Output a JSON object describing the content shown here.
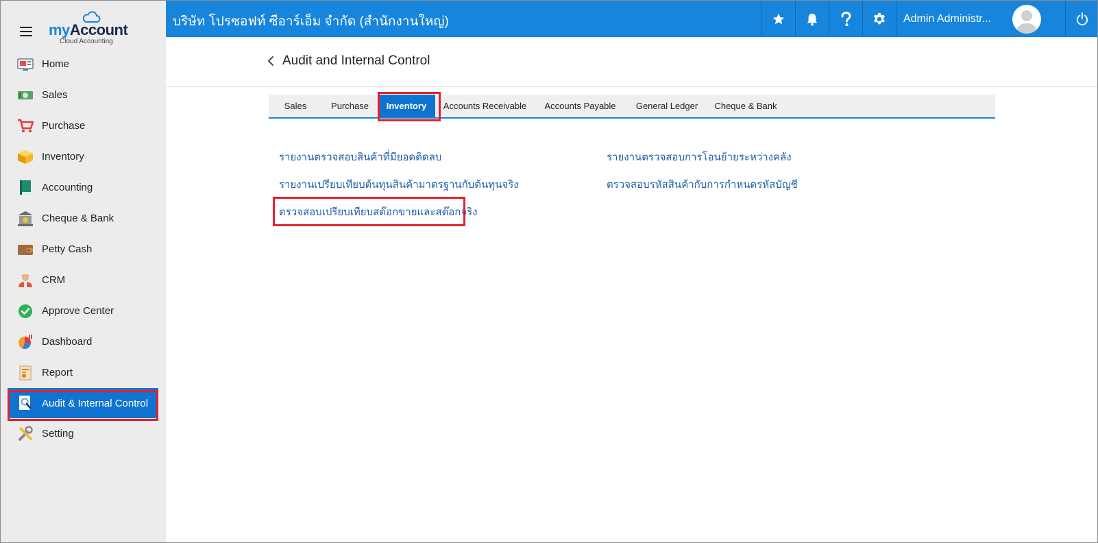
{
  "app": {
    "logo_my": "my",
    "logo_account": "Account",
    "logo_sub": "Cloud Accounting"
  },
  "topbar": {
    "company": "บริษัท โปรซอฟท์ ซีอาร์เอ็ม จำกัด (สำนักงานใหญ่)",
    "user_name": "Admin Administr..."
  },
  "sidebar": {
    "items": [
      {
        "label": "Home",
        "icon": "home-icon"
      },
      {
        "label": "Sales",
        "icon": "sales-icon"
      },
      {
        "label": "Purchase",
        "icon": "cart-icon"
      },
      {
        "label": "Inventory",
        "icon": "box-icon"
      },
      {
        "label": "Accounting",
        "icon": "book-icon"
      },
      {
        "label": "Cheque & Bank",
        "icon": "bank-icon"
      },
      {
        "label": "Petty Cash",
        "icon": "wallet-icon"
      },
      {
        "label": "CRM",
        "icon": "crm-icon"
      },
      {
        "label": "Approve Center",
        "icon": "check-circle-icon"
      },
      {
        "label": "Dashboard",
        "icon": "pie-chart-icon"
      },
      {
        "label": "Report",
        "icon": "report-icon"
      },
      {
        "label": "Audit & Internal Control",
        "icon": "audit-icon"
      },
      {
        "label": "Setting",
        "icon": "tools-icon"
      }
    ],
    "active_index": 11
  },
  "page": {
    "title": "Audit and Internal Control"
  },
  "tabs": [
    {
      "label": "Sales"
    },
    {
      "label": "Purchase"
    },
    {
      "label": "Inventory"
    },
    {
      "label": "Accounts Receivable"
    },
    {
      "label": "Accounts Payable"
    },
    {
      "label": "General Ledger"
    },
    {
      "label": "Cheque & Bank"
    }
  ],
  "active_tab": "Inventory",
  "links": {
    "left": [
      "รายงานตรวจสอบสินค้าที่มียอดติดลบ",
      "รายงานเปรียบเทียบต้นทุนสินค้ามาตรฐานกับต้นทุนจริง",
      "ตรวจสอบเปรียบเทียบสต๊อกขายและสต๊อกจริง"
    ],
    "right": [
      "รายงานตรวจสอบการโอนย้ายระหว่างคลัง",
      "ตรวจสอบรหัสสินค้ากับการกำหนดรหัสบัญชี"
    ]
  },
  "colors": {
    "brand": "#1785db",
    "active": "#0f74cf",
    "highlight": "#e5202e",
    "link": "#1f5fa8"
  }
}
